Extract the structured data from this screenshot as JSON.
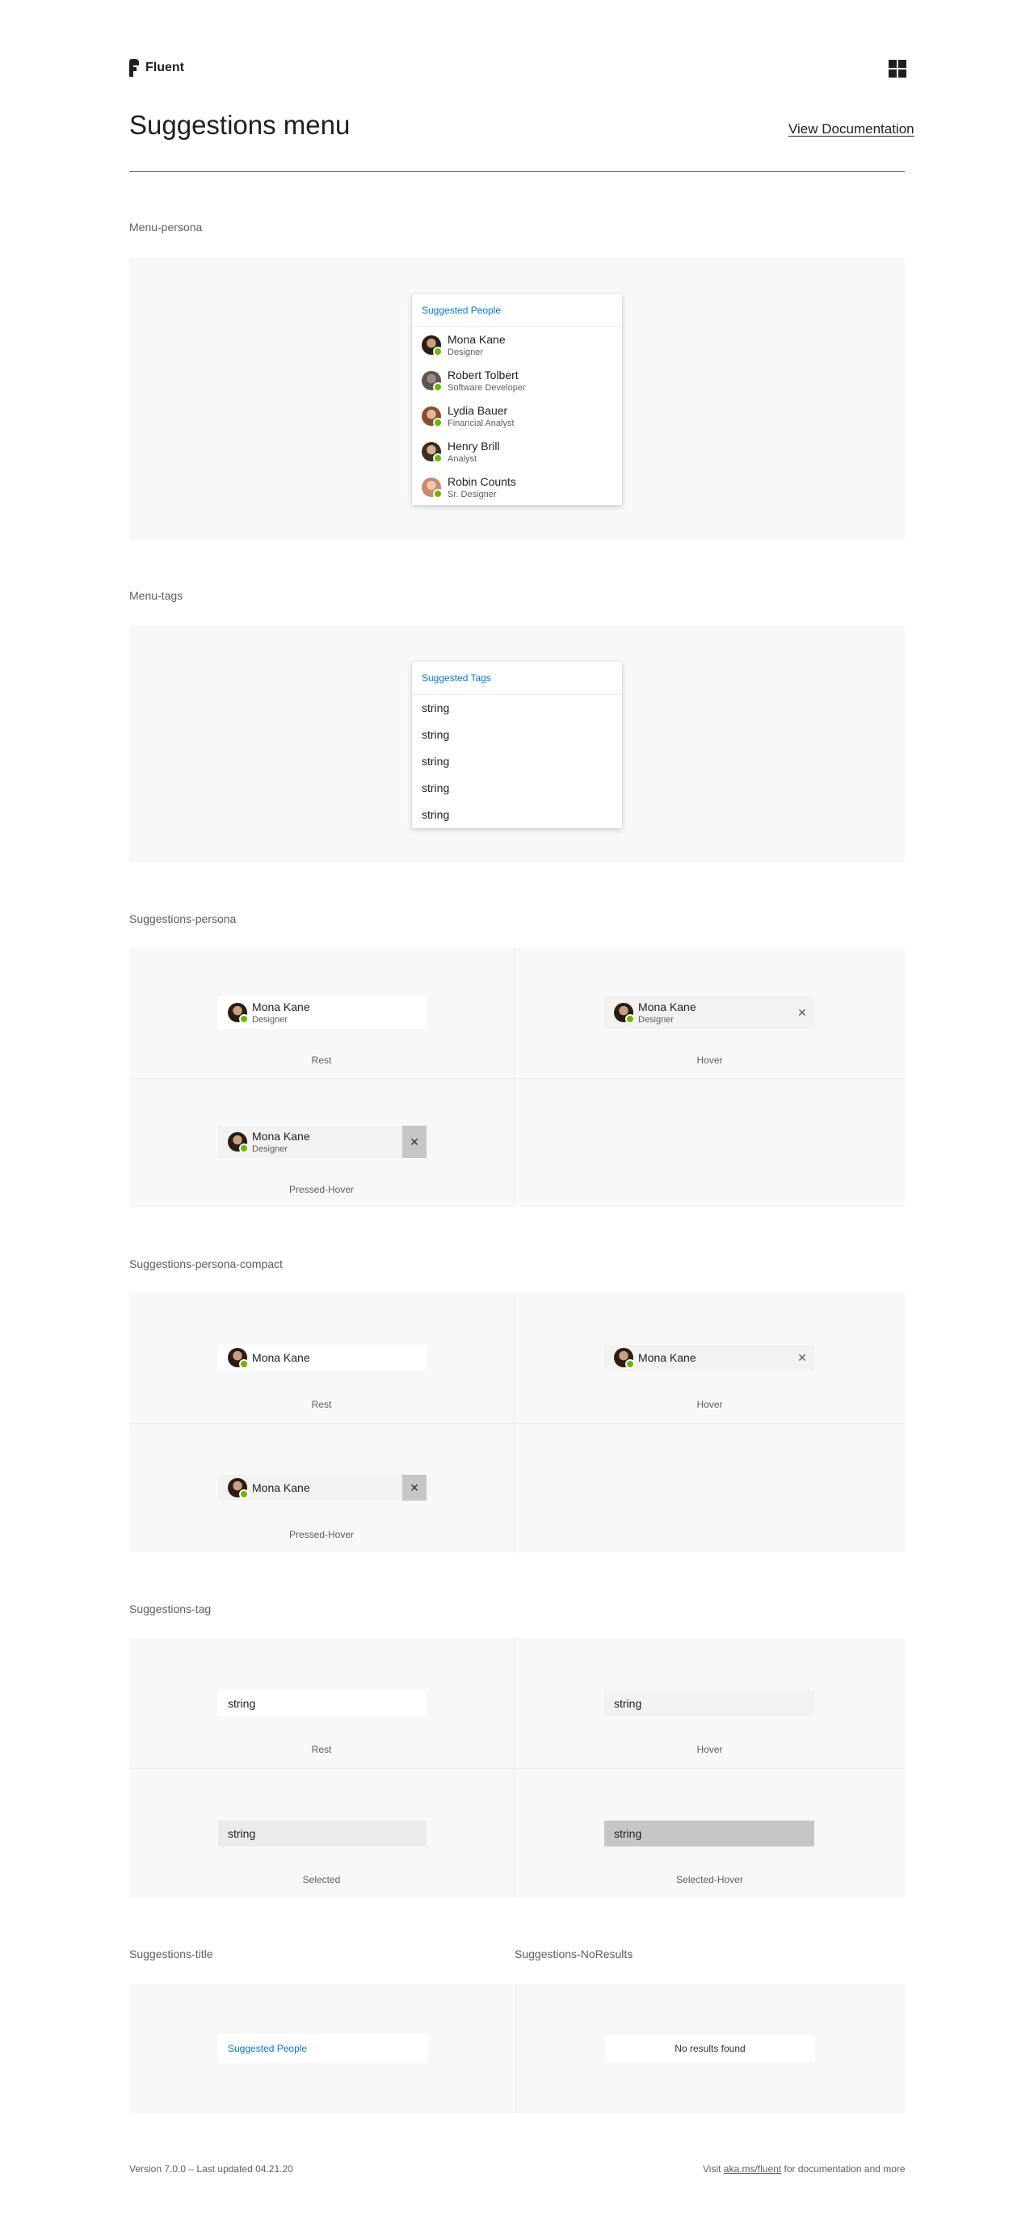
{
  "brand": {
    "name": "Fluent"
  },
  "header": {
    "title": "Suggestions menu",
    "doc_link": "View Documentation",
    "grid_icon": "windows-grid-icon"
  },
  "colors": {
    "accent": "#0078d4",
    "presence": "#6bb700",
    "panel": "#f8f8f8",
    "pressed": "#c8c6c4",
    "hover": "#f3f2f1"
  },
  "menu_persona": {
    "label": "Menu-persona",
    "title": "Suggested People",
    "people": [
      {
        "name": "Mona Kane",
        "role": "Designer"
      },
      {
        "name": "Robert Tolbert",
        "role": "Software Developer"
      },
      {
        "name": "Lydia Bauer",
        "role": "Financial Analyst"
      },
      {
        "name": "Henry Brill",
        "role": "Analyst"
      },
      {
        "name": "Robin Counts",
        "role": "Sr. Designer"
      }
    ]
  },
  "menu_tags": {
    "label": "Menu-tags",
    "title": "Suggested Tags",
    "tags": [
      "string",
      "string",
      "string",
      "string",
      "string"
    ]
  },
  "suggestions_persona": {
    "label": "Suggestions-persona",
    "name": "Mona Kane",
    "role": "Designer",
    "states": [
      "Rest",
      "Hover",
      "Pressed-Hover"
    ]
  },
  "suggestions_persona_compact": {
    "label": "Suggestions-persona-compact",
    "name": "Mona Kane",
    "states": [
      "Rest",
      "Hover",
      "Pressed-Hover"
    ]
  },
  "suggestions_tag": {
    "label": "Suggestions-tag",
    "value": "string",
    "states": [
      "Rest",
      "Hover",
      "Selected",
      "Selected-Hover"
    ]
  },
  "suggestions_title": {
    "label": "Suggestions-title",
    "text": "Suggested People"
  },
  "suggestions_noresults": {
    "label": "Suggestions-NoResults",
    "text": "No results found"
  },
  "footer": {
    "version": "Version 7.0.0 – Last updated 04.21.20",
    "visit_prefix": "Visit ",
    "visit_link": "aka.ms/fluent",
    "visit_suffix": " for documentation and more"
  }
}
